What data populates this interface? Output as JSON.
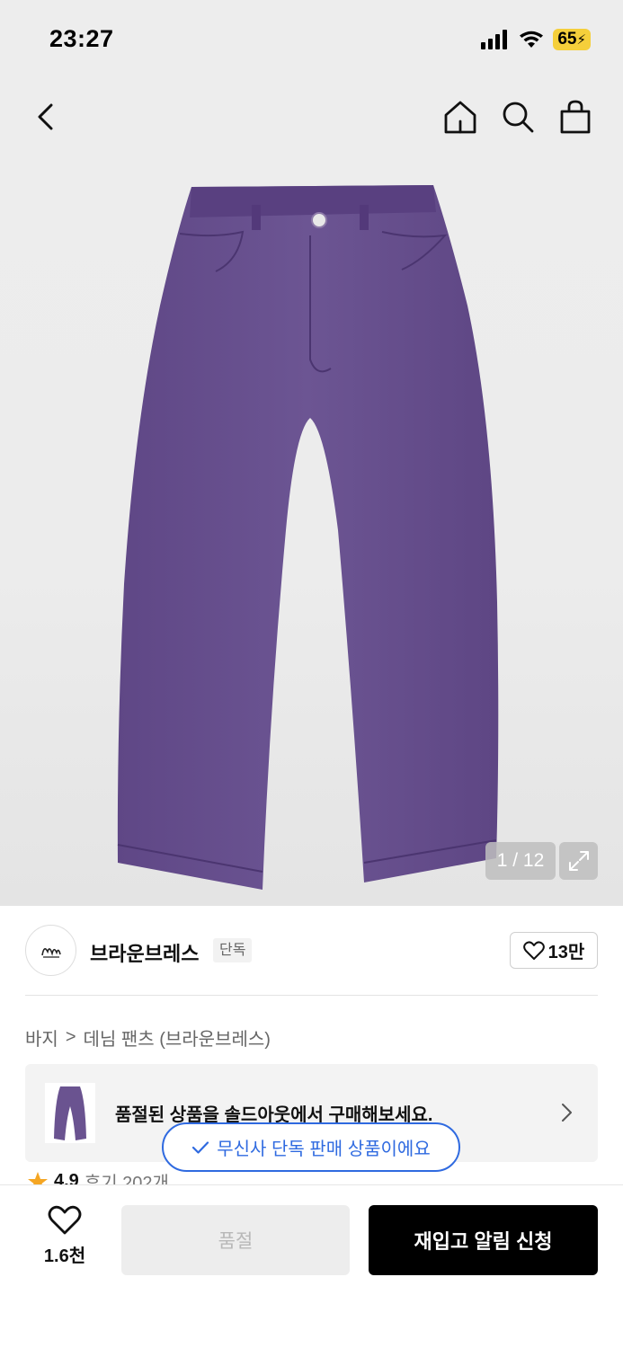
{
  "status_bar": {
    "time": "23:27",
    "battery": "65",
    "icons": [
      "cellular-signal-icon",
      "wifi-icon",
      "battery-charging-icon"
    ]
  },
  "nav": {
    "icons": [
      "back-chevron-icon",
      "home-icon",
      "search-icon",
      "shopping-bag-icon"
    ]
  },
  "product_image": {
    "counter": "1 / 12",
    "icon": "expand-icon"
  },
  "brand": {
    "name": "브라운브레스",
    "tag": "단독",
    "likes": "13만",
    "icon": "heart-outline-icon"
  },
  "breadcrumb": {
    "items": [
      "바지",
      "데님 팬츠 (브라운브레스)"
    ],
    "separator": ">"
  },
  "soldout_banner": {
    "text": "품절된 상품을 솔드아웃에서 구매해보세요.",
    "icon": "chevron-right-icon"
  },
  "exclusive_pill": {
    "text": "무신사 단독 판매 상품이에요",
    "icon": "check-icon",
    "color": "#2f6ae0"
  },
  "rating": {
    "value": "4.9",
    "reviews": "후기 202개",
    "icon": "star-icon",
    "star_color": "#f5a623"
  },
  "bottom_bar": {
    "wish_count": "1.6천",
    "soldout_label": "품절",
    "restock_label": "재입고 알림 신청"
  },
  "colors": {
    "product_purple": "#6a5390",
    "restock_button": "#000000"
  }
}
